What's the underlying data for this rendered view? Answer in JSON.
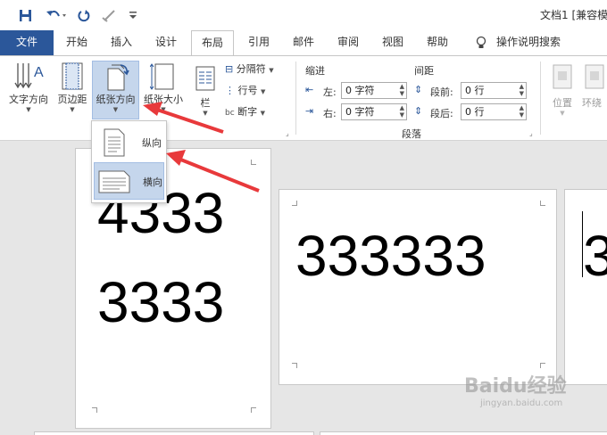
{
  "window": {
    "title": "文档1 [兼容模"
  },
  "quick_access": {
    "save_icon": "save-icon",
    "undo_icon": "undo-icon",
    "redo_icon": "redo-icon",
    "format_painter_icon": "format-painter-icon",
    "customize_icon": "customize-qat-icon"
  },
  "tabs": [
    {
      "label": "文件"
    },
    {
      "label": "开始"
    },
    {
      "label": "插入"
    },
    {
      "label": "设计"
    },
    {
      "label": "布局"
    },
    {
      "label": "引用"
    },
    {
      "label": "邮件"
    },
    {
      "label": "审阅"
    },
    {
      "label": "视图"
    },
    {
      "label": "帮助"
    },
    {
      "label": "操作说明搜索"
    }
  ],
  "ribbon": {
    "page_setup": {
      "text_direction": "文字方向",
      "margins": "页边距",
      "orientation": "纸张方向",
      "size": "纸张大小",
      "columns": "栏",
      "breaks": "分隔符",
      "line_numbers": "行号",
      "hyphenation": "断字"
    },
    "paragraph": {
      "title": "段落",
      "indent_label": "缩进",
      "spacing_label": "间距",
      "left_label": "左:",
      "right_label": "右:",
      "before_label": "段前:",
      "after_label": "段后:",
      "left_value": "0 字符",
      "right_value": "0 字符",
      "before_value": "0 行",
      "after_value": "0 行"
    },
    "arrange": {
      "position": "位置",
      "wrap": "环绕"
    }
  },
  "orientation_menu": {
    "items": [
      {
        "label": "纵向",
        "icon": "portrait-page-icon"
      },
      {
        "label": "横向",
        "icon": "landscape-page-icon",
        "selected": true
      }
    ]
  },
  "pages": [
    {
      "lines": [
        "4333",
        "3333"
      ]
    },
    {
      "lines": [
        "333333"
      ]
    },
    {
      "lines": [
        "3"
      ]
    }
  ],
  "watermark": {
    "brand": "Baidu经验",
    "url": "jingyan.baidu.com"
  },
  "colors": {
    "accent": "#2b579a",
    "arrow": "#e8393b",
    "selected": "#c5d6ec"
  }
}
